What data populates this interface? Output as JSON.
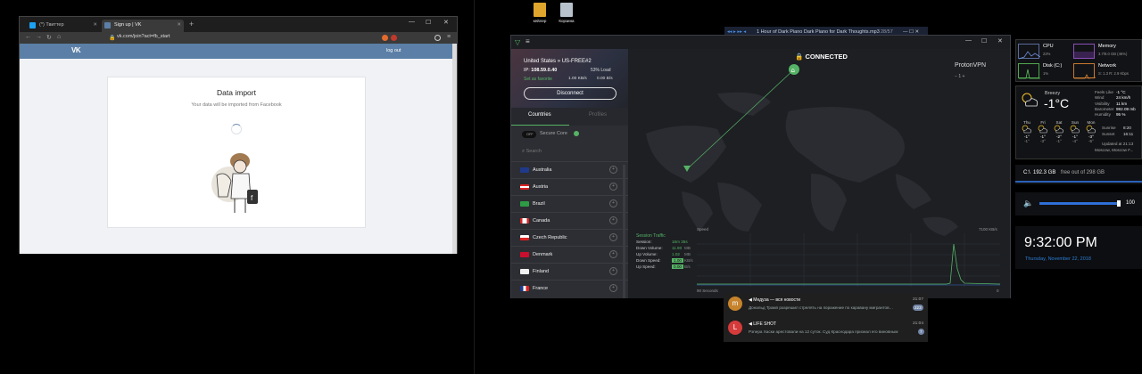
{
  "browser": {
    "tabs": [
      {
        "label": "(*) Твиттер"
      },
      {
        "label": "Sign up | VK"
      }
    ],
    "new_tab": "+",
    "url": "vk.com/join?act=fb_start",
    "vk_logo": "VK",
    "logout": "log out",
    "card_title": "Data import",
    "card_subtitle": "Your data will be imported from Facebook"
  },
  "desktop": {
    "icons": [
      {
        "label": "кейлер",
        "icon": "folder-icon"
      },
      {
        "label": "Корзина",
        "icon": "recycle-bin-icon"
      }
    ]
  },
  "player": {
    "track": "1 Hour of Dark Piano Dark Piano for Dark Thoughts.mp3",
    "time": "28/57"
  },
  "vpn": {
    "server": "United States » US-FREE#2",
    "ip_label": "IP:",
    "ip": "108.59.0.40",
    "load": "53% Load",
    "seed": "Set as favorite",
    "down": "1.00 KB/s",
    "up": "0.00 B/s",
    "disconnect": "Disconnect",
    "tabs": {
      "countries": "Countries",
      "profiles": "Profiles"
    },
    "secure_core_toggle": "OFF",
    "secure_core": "Secure Core",
    "search_placeholder": "Search",
    "countries": [
      "Australia",
      "Austria",
      "Brazil",
      "Canada",
      "Czech Republic",
      "Denmark",
      "Finland",
      "France"
    ],
    "status": "CONNECTED",
    "brand": "ProtonVPN",
    "zoom": "1",
    "traffic": {
      "title": "Session Traffic",
      "rows": [
        {
          "label": "Session:",
          "value": "16m 35s"
        },
        {
          "label": "Down Volume:",
          "value": "11.90",
          "unit": "MB"
        },
        {
          "label": "Up Volume:",
          "value": "1.02",
          "unit": "MB"
        },
        {
          "label": "Down Speed:",
          "value": "1.00",
          "unit": "KB/s"
        },
        {
          "label": "Up Speed:",
          "value": "0.00",
          "unit": "B/s"
        }
      ],
      "speed_label": "Speed",
      "speed_max": "7100 KB/s",
      "time_label": "90 Seconds",
      "time_end": "0"
    }
  },
  "telegram": [
    {
      "name": "Медуза — вся новости",
      "time": "21:07",
      "msg": "Дональд Трамп разрешил стрелять на поражение по каравану мигрантов…",
      "badge": "223",
      "color": "#c7832c",
      "av": "m"
    },
    {
      "name": "LIFE SHOT",
      "time": "21:04",
      "msg": "Рэпера Хаски арестовали на 12 суток. Суд Краснодара признал его виновным…",
      "badge": "7",
      "color": "#d53b3b",
      "av": "L"
    }
  ],
  "perf": {
    "cpu": {
      "label": "CPU",
      "sub": "22%"
    },
    "memory": {
      "label": "Memory",
      "sub": "3.7/8.0 GB (46%)"
    },
    "disk": {
      "label": "Disk (C:)",
      "sub": "1%"
    },
    "network": {
      "label": "Network",
      "sub": "S: 1.3 R: 2.9 Kbps"
    }
  },
  "weather": {
    "cond": "Breezy",
    "temp": "-1°C",
    "details": [
      {
        "k": "Feels Like",
        "v": "-1 °C"
      },
      {
        "k": "Wind",
        "v": "24 km/h"
      },
      {
        "k": "Visibility",
        "v": "11 km"
      },
      {
        "k": "Barometer",
        "v": "992.09 mb"
      },
      {
        "k": "Humidity",
        "v": "95 %"
      }
    ],
    "days": [
      "Thu",
      "Fri",
      "Sat",
      "Sun",
      "Mon"
    ],
    "highs": [
      "-1°",
      "-1°",
      "-2°",
      "-1°",
      "-3°"
    ],
    "lows": [
      "-1°",
      "-3°",
      "-1°",
      "-4°",
      "-5°"
    ],
    "sunrise_label": "Sunrise",
    "sunrise": "8:20",
    "sunset_label": "Sunset",
    "sunset": "16:11",
    "updated": "Updated at 21:13",
    "location": "Moscow, Moscow F..."
  },
  "disk": {
    "drive": "C:\\",
    "free": "192.3 GB",
    "total": "free out of 298 GB"
  },
  "volume": {
    "value": "100",
    "level": 1.0
  },
  "clock": {
    "time": "9:32:00 PM",
    "date": "Thursday, November 22, 2018"
  }
}
